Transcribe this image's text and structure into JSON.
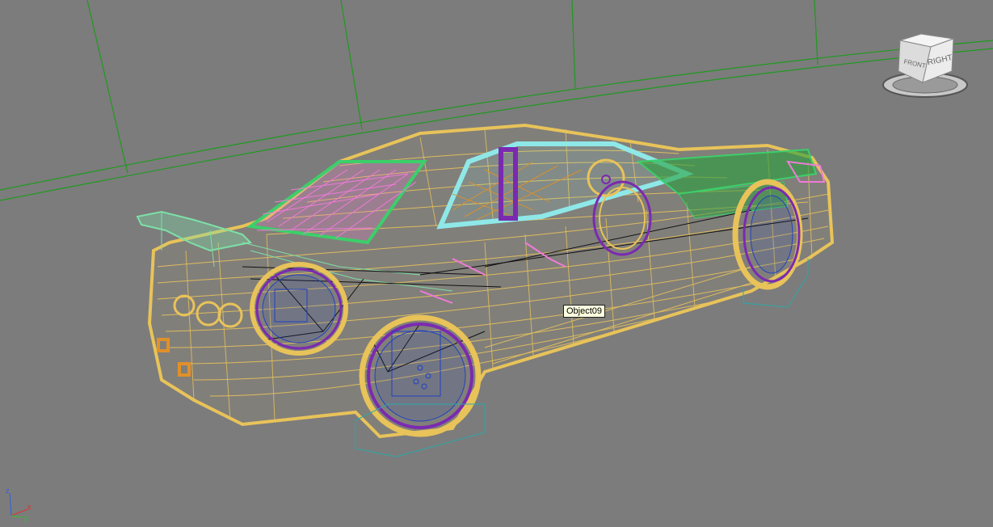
{
  "viewport": {
    "background": "#7c7c7c",
    "grid_color": "#1f9a1f"
  },
  "tooltip": {
    "object_name": "Object09"
  },
  "viewcube": {
    "left_face": "FRONT",
    "right_face": "RIGHT"
  },
  "axis_tripod": {
    "x_label": "x",
    "y_label": "y",
    "z_label": "z",
    "x_color": "#e03030",
    "y_color": "#30c030",
    "z_color": "#3060e0"
  },
  "model": {
    "colors": {
      "body": "#e8c35a",
      "pink": "#f07ad8",
      "green": "#3ccf6a",
      "mint": "#7de0a8",
      "cyan": "#8fe8e8",
      "purple": "#7a2ab0",
      "black": "#111111",
      "orange": "#e0902a",
      "teal": "#2aa8a8",
      "blue": "#2040c0"
    }
  }
}
